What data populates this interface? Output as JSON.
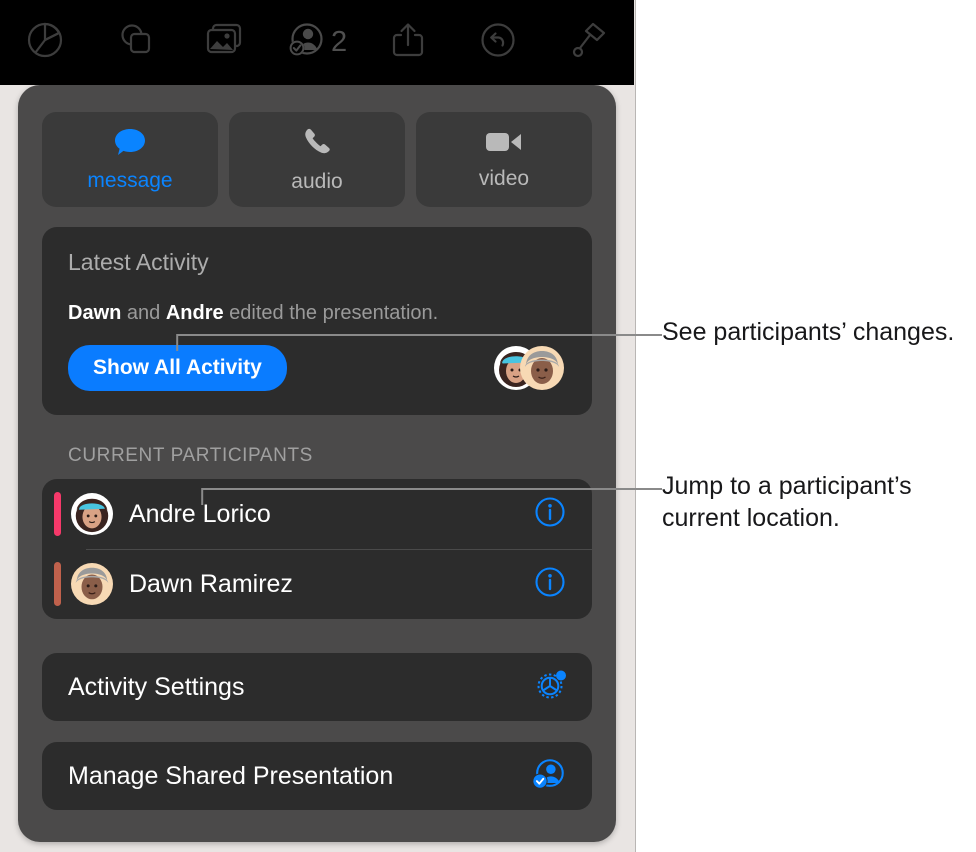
{
  "toolbar": {
    "items": [
      {
        "icon": "chart-pie-icon",
        "label": ""
      },
      {
        "icon": "shapes-icon",
        "label": ""
      },
      {
        "icon": "media-photos-icon",
        "label": ""
      },
      {
        "icon": "collaborate-person-check-icon",
        "label": "2"
      },
      {
        "icon": "share-up-arrow-icon",
        "label": ""
      },
      {
        "icon": "undo-arrow-icon",
        "label": ""
      },
      {
        "icon": "format-brush-icon",
        "label": ""
      }
    ],
    "participant_count": "2"
  },
  "popover": {
    "call_buttons": [
      {
        "label": "message",
        "icon": "message-bubble-icon",
        "enabled": true
      },
      {
        "label": "audio",
        "icon": "phone-handset-icon",
        "enabled": false
      },
      {
        "label": "video",
        "icon": "video-camera-icon",
        "enabled": false
      }
    ],
    "latest_activity": {
      "title": "Latest Activity",
      "line_prefix": "",
      "name_1": "Dawn",
      "conjunction": " and ",
      "name_2": "Andre",
      "line_suffix": " edited the presentation.",
      "show_all_label": "Show All Activity",
      "avatars": [
        {
          "name": "avatar-andre",
          "face": "teal-hat-memoji",
          "bg": "#ffffff"
        },
        {
          "name": "avatar-dawn",
          "face": "gray-hair-memoji",
          "bg": "#f5d6b0"
        }
      ]
    },
    "participants_section": {
      "header": "CURRENT PARTICIPANTS",
      "rows": [
        {
          "name": "Andre Lorico",
          "bar_color": "#f6396a",
          "avatar_bg": "#ffffff",
          "avatar_face": "teal-hat-memoji",
          "info_icon": "info-circle-icon"
        },
        {
          "name": "Dawn Ramirez",
          "bar_color": "#c0614c",
          "avatar_bg": "#f5d6b0",
          "avatar_face": "gray-hair-memoji",
          "info_icon": "info-circle-icon"
        }
      ]
    },
    "actions": [
      {
        "label": "Activity Settings",
        "icon": "gear-activity-icon"
      },
      {
        "label": "Manage Shared Presentation",
        "icon": "manage-shared-person-check-icon"
      }
    ]
  },
  "callouts": [
    {
      "text": "See participants’ changes."
    },
    {
      "text": "Jump to a participant’s current location."
    }
  ],
  "colors": {
    "accent_blue": "#0a7cff",
    "toolbar_black": "#000000",
    "popover_gray": "#4b4a4a",
    "card_dark": "#2c2c2c",
    "paper": "#e9e5e3",
    "andre_bar": "#f6396a",
    "dawn_bar": "#c0614c"
  }
}
